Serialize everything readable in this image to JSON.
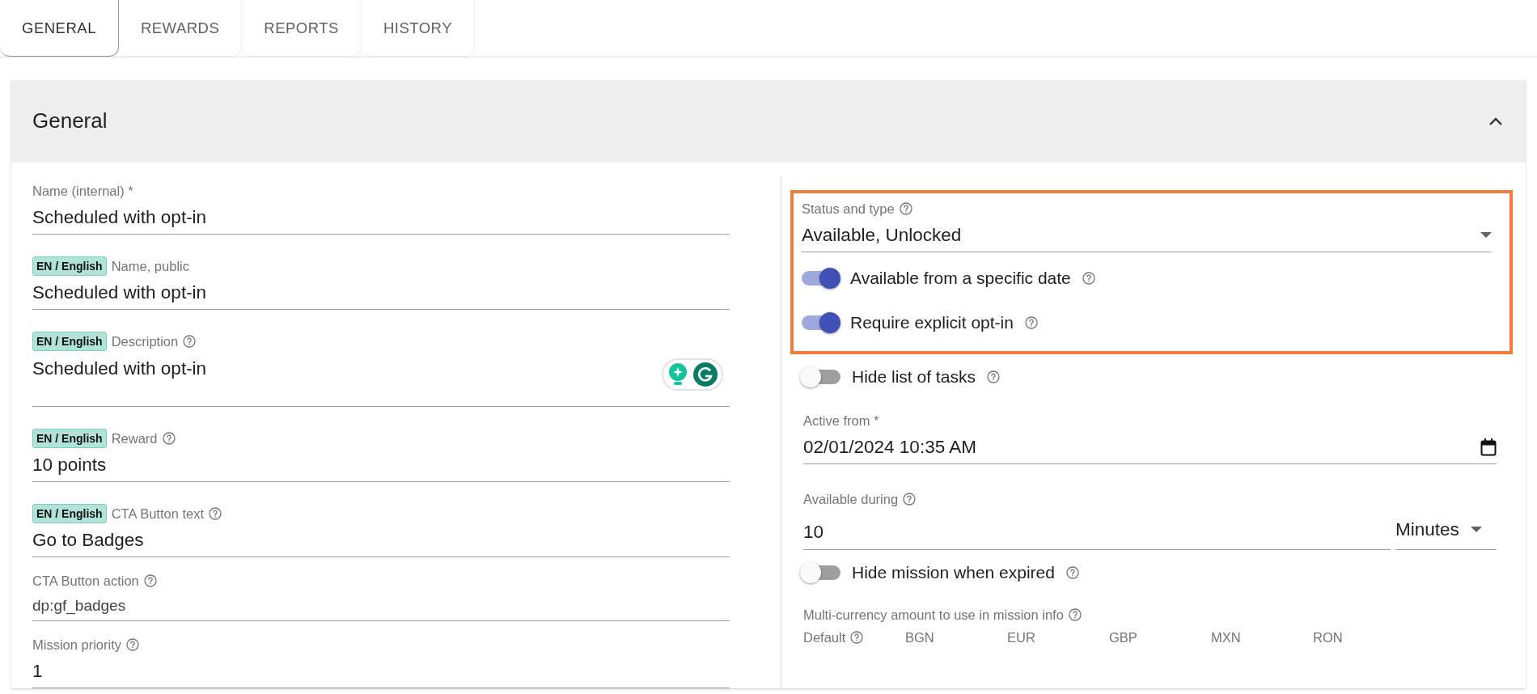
{
  "tabs": [
    {
      "label": "GENERAL",
      "selected": true
    },
    {
      "label": "REWARDS",
      "selected": false
    },
    {
      "label": "REPORTS",
      "selected": false
    },
    {
      "label": "HISTORY",
      "selected": false
    }
  ],
  "section": {
    "title": "General",
    "expanded": true
  },
  "left_fields": [
    {
      "kind": "text",
      "label": "Name (internal) *",
      "value": "Scheduled with opt-in",
      "help": false
    },
    {
      "kind": "text",
      "badge": "EN / English",
      "label": "Name, public",
      "value": "Scheduled with opt-in",
      "help": false
    },
    {
      "kind": "textarea",
      "badge": "EN / English",
      "label": "Description",
      "value": "Scheduled with opt-in",
      "help": true
    },
    {
      "kind": "text",
      "badge": "EN / English",
      "label": "Reward",
      "value": "10 points",
      "help": true
    },
    {
      "kind": "text",
      "badge": "EN / English",
      "label": "CTA Button text",
      "value": "Go to Badges",
      "help": true
    },
    {
      "kind": "code",
      "label": "CTA Button action",
      "value": "dp:gf_badges",
      "help": true
    },
    {
      "kind": "text",
      "label": "Mission priority",
      "value": "1",
      "help": true
    }
  ],
  "right_items": [
    {
      "kind": "select",
      "label": "Status and type",
      "value": "Available, Unlocked",
      "help": true,
      "highlighted": true
    },
    {
      "kind": "toggle",
      "label": "Available from a specific date",
      "on": true,
      "help": true,
      "highlighted": true
    },
    {
      "kind": "toggle",
      "label": "Require explicit opt-in",
      "on": true,
      "help": true,
      "highlighted": true
    },
    {
      "kind": "toggle",
      "label": "Hide list of tasks",
      "on": false,
      "help": true,
      "highlighted": false
    },
    {
      "kind": "datetime",
      "label": "Active from *",
      "value": "02/01/2024 10:35 AM",
      "help": false,
      "highlighted": false
    },
    {
      "kind": "duration",
      "label": "Available during",
      "value": "10",
      "unit": "Minutes",
      "help": true,
      "highlighted": false
    },
    {
      "kind": "toggle",
      "label": "Hide mission when expired",
      "on": false,
      "help": true,
      "highlighted": false
    },
    {
      "kind": "currency",
      "label": "Multi-currency amount to use in mission info",
      "help": true,
      "highlighted": false,
      "default_label": "Default",
      "currencies": [
        "BGN",
        "EUR",
        "GBP",
        "MXN",
        "RON"
      ]
    }
  ]
}
